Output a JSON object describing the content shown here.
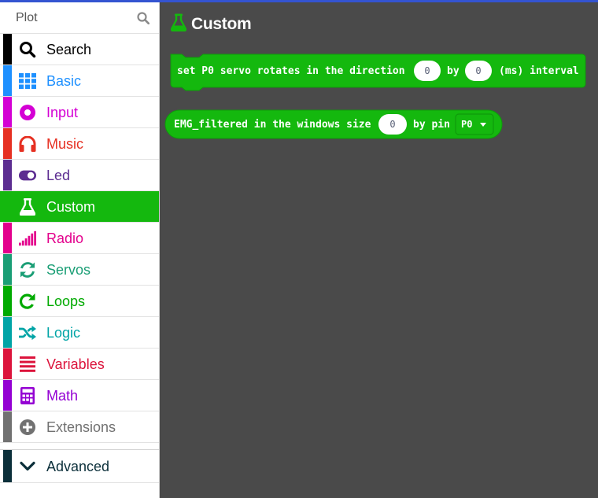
{
  "search": {
    "placeholder": "Plot",
    "icon": "search-icon"
  },
  "categories": [
    {
      "label": "Search",
      "color": "#000000",
      "icon": "search-icon"
    },
    {
      "label": "Basic",
      "color": "#1e90ff",
      "icon": "grid-icon"
    },
    {
      "label": "Input",
      "color": "#d400d4",
      "icon": "circle-dot-icon"
    },
    {
      "label": "Music",
      "color": "#e63022",
      "icon": "headphones-icon"
    },
    {
      "label": "Led",
      "color": "#5c2d91",
      "icon": "toggle-icon"
    },
    {
      "label": "Custom",
      "color": "#14b80e",
      "icon": "flask-icon",
      "selected": true
    },
    {
      "label": "Radio",
      "color": "#e3008c",
      "icon": "signal-bars-icon"
    },
    {
      "label": "Servos",
      "color": "#1a9e75",
      "icon": "refresh-icon"
    },
    {
      "label": "Loops",
      "color": "#00aa00",
      "icon": "loop-icon"
    },
    {
      "label": "Logic",
      "color": "#00a4a6",
      "icon": "shuffle-icon"
    },
    {
      "label": "Variables",
      "color": "#dc143c",
      "icon": "list-icon"
    },
    {
      "label": "Math",
      "color": "#9400d3",
      "icon": "calculator-icon"
    },
    {
      "label": "Extensions",
      "color": "#717171",
      "icon": "plus-circle-icon"
    }
  ],
  "advanced": {
    "label": "Advanced",
    "color": "#0b2f3a",
    "icon": "chevron-down-icon"
  },
  "workspace": {
    "title": "Custom",
    "title_icon": "flask-icon",
    "accent": "#14b80e",
    "background": "#4a4a4a",
    "blocks": [
      {
        "kind": "statement",
        "text_1": "set P0 servo rotates in the direction",
        "value_1": "0",
        "text_2": "by",
        "value_2": "0",
        "text_3": "(ms) interval"
      },
      {
        "kind": "reporter",
        "text_1": "EMG_filtered in the windows size",
        "value_1": "0",
        "text_2": "by pin",
        "dropdown": "P0"
      }
    ]
  }
}
